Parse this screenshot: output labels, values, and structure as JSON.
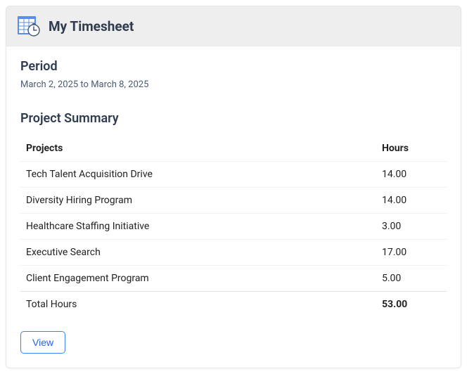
{
  "header": {
    "title": "My Timesheet"
  },
  "period": {
    "label": "Period",
    "text": "March 2, 2025 to March 8, 2025"
  },
  "summary": {
    "label": "Project Summary",
    "columns": {
      "project": "Projects",
      "hours": "Hours"
    },
    "rows": [
      {
        "project": "Tech Talent Acquisition Drive",
        "hours": "14.00"
      },
      {
        "project": "Diversity Hiring Program",
        "hours": "14.00"
      },
      {
        "project": "Healthcare Staffing Initiative",
        "hours": "3.00"
      },
      {
        "project": "Executive Search",
        "hours": "17.00"
      },
      {
        "project": "Client Engagement Program",
        "hours": "5.00"
      }
    ],
    "total": {
      "label": "Total Hours",
      "hours": "53.00"
    }
  },
  "actions": {
    "view": "View"
  }
}
